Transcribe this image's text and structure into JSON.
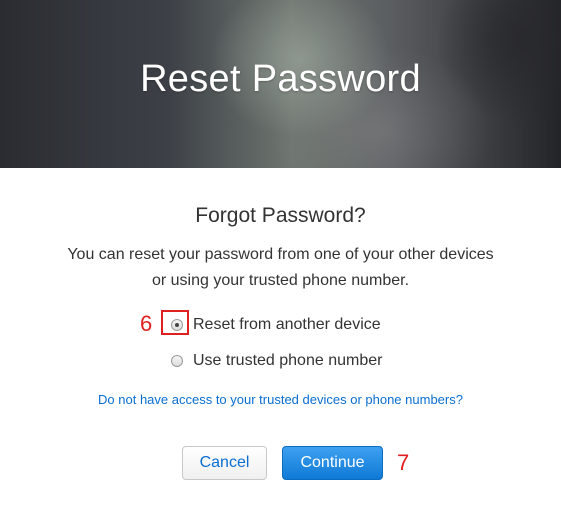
{
  "header": {
    "title": "Reset Password"
  },
  "content": {
    "subheading": "Forgot Password?",
    "description_line1": "You can reset your password from one of your other devices",
    "description_line2": "or using your trusted phone number.",
    "options": [
      {
        "label": "Reset from another device",
        "selected": true
      },
      {
        "label": "Use trusted phone number",
        "selected": false
      }
    ],
    "help_link": "Do not have access to your trusted devices or phone numbers?"
  },
  "buttons": {
    "cancel_label": "Cancel",
    "continue_label": "Continue"
  },
  "annotations": {
    "step_6": "6",
    "step_7": "7"
  },
  "colors": {
    "link": "#0a6ed1",
    "primary_button": "#1a86e0",
    "annotation": "#e02020"
  }
}
